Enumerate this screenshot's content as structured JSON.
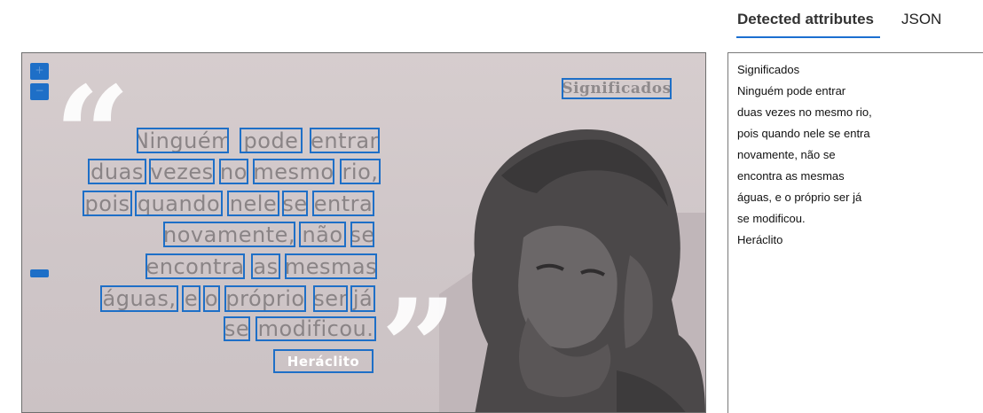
{
  "tabs": [
    {
      "label": "Detected attributes",
      "active": true
    },
    {
      "label": "JSON",
      "active": false
    }
  ],
  "attributes": [
    "Significados",
    "Ninguém pode entrar",
    "duas vezes no mesmo rio,",
    "pois quando nele se entra",
    "novamente, não se",
    "encontra as mesmas",
    "águas, e o próprio ser já",
    "se modificou.",
    "Heráclito"
  ],
  "image": {
    "watermark": "Significados",
    "words": [
      "Ninguém",
      "pode",
      "entrar",
      "duas",
      "vezes",
      "no",
      "mesmo",
      "rio,",
      "pois",
      "quando",
      "nele",
      "se",
      "entra",
      "novamente,",
      "não",
      "se",
      "encontra",
      "as",
      "mesmas",
      "águas,",
      "e",
      "o",
      "próprio",
      "ser",
      "já",
      "se",
      "modificou."
    ],
    "author": "Heráclito",
    "open_quote": "“",
    "close_quote": "”"
  },
  "controls": {
    "zoom_in_icon": "plus-icon",
    "zoom_out_icon": "minus-icon",
    "zoom_in_glyph": "+",
    "zoom_out_glyph": "−"
  },
  "colors": {
    "accent": "#1e6fc7",
    "box": "#1e6fc7"
  }
}
